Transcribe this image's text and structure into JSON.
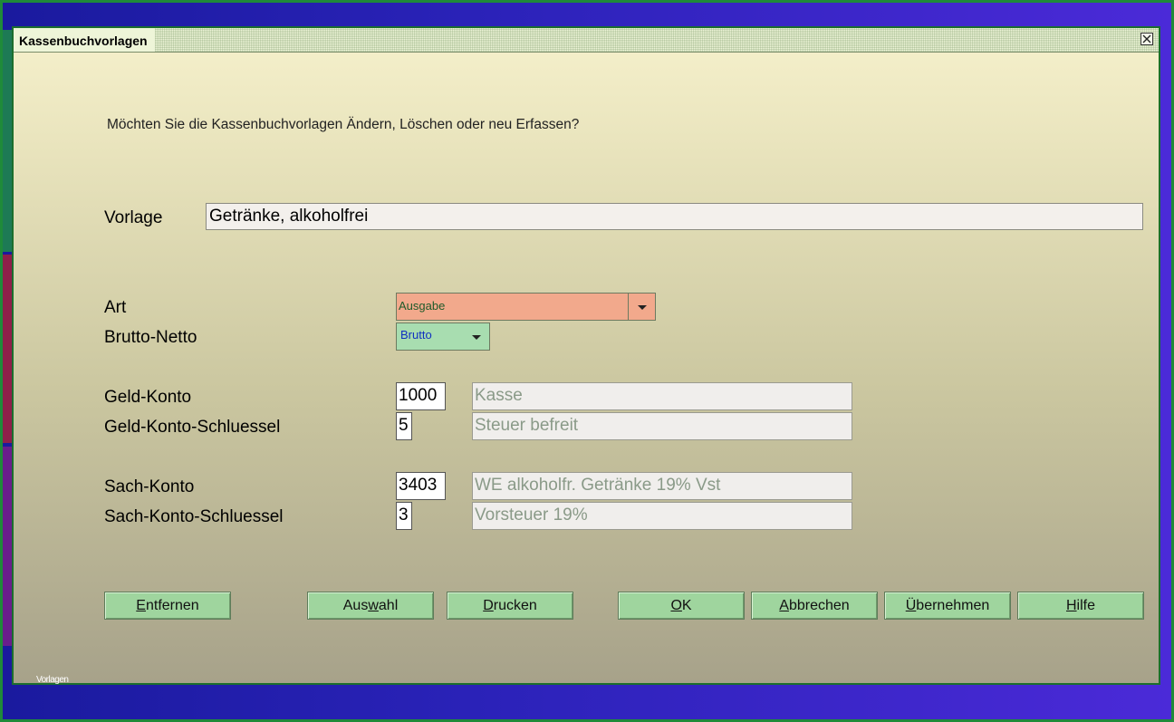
{
  "window": {
    "title": "Kassenbuchvorlagen",
    "close_icon": "close-icon"
  },
  "prompt": "Möchten Sie die Kassenbuchvorlagen Ändern, Löschen oder neu Erfassen?",
  "form": {
    "vorlage": {
      "label": "Vorlage",
      "value": "Getränke, alkoholfrei"
    },
    "art": {
      "label": "Art",
      "value": "Ausgabe"
    },
    "brutto_netto": {
      "label": "Brutto-Netto",
      "value": "Brutto"
    },
    "geld_konto": {
      "label": "Geld-Konto",
      "number": "1000",
      "name": "Kasse"
    },
    "geld_konto_schluessel": {
      "label": "Geld-Konto-Schluessel",
      "number": "5",
      "name": "Steuer befreit"
    },
    "sach_konto": {
      "label": "Sach-Konto",
      "number": "3403",
      "name": "WE alkoholfr. Getränke 19% Vst"
    },
    "sach_konto_schluessel": {
      "label": "Sach-Konto-Schluessel",
      "number": "3",
      "name": "Vorsteuer 19%"
    }
  },
  "buttons": {
    "entfernen": {
      "mn": "E",
      "rest": "ntfernen"
    },
    "auswahl": {
      "pre": "Aus",
      "mn": "w",
      "rest": "ahl"
    },
    "drucken": {
      "mn": "D",
      "rest": "rucken"
    },
    "ok": {
      "mn": "O",
      "rest": "K"
    },
    "abbrechen": {
      "mn": "A",
      "rest": "bbrechen"
    },
    "uebernehmen": {
      "mn": "Ü",
      "rest": "bernehmen"
    },
    "hilfe": {
      "mn": "H",
      "rest": "ilfe"
    }
  },
  "status": "Vorlagen",
  "colors": {
    "art_dropdown": "#f2a98c",
    "brutto_dropdown": "#a8ddb0",
    "button": "#9fd59e",
    "art_value_text": "#1e5a2a",
    "brutto_value_text": "#1030c0"
  }
}
